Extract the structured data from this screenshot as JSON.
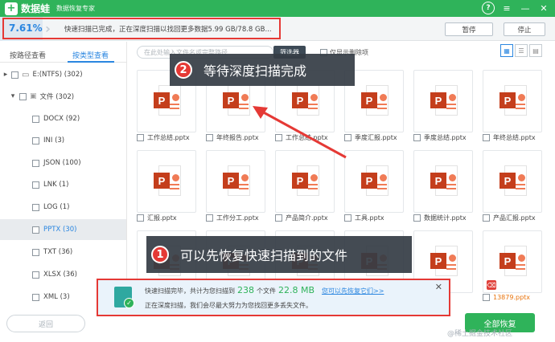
{
  "titlebar": {
    "logo_glyph": "+",
    "app_name": "数据蛙",
    "app_subtitle": "数据恢复专家",
    "controls": [
      {
        "name": "help-icon",
        "glyph": "?"
      },
      {
        "name": "menu-icon",
        "glyph": "≡"
      },
      {
        "name": "minimize-icon",
        "glyph": "—"
      },
      {
        "name": "close-icon",
        "glyph": "✕"
      }
    ]
  },
  "progress": {
    "percent_text": "7.61%",
    "fraction": 0.0761,
    "status_text": "快速扫描已完成，正在深度扫描以找回更多数据5.99 GB/78.8 GB...",
    "pause_label": "暂停",
    "stop_label": "停止"
  },
  "sidebar": {
    "tab_path": "按路径查看",
    "tab_type": "按类型查看",
    "active_tab": "type",
    "tree": [
      {
        "label": "E:(NTFS) (302)",
        "level": 0,
        "caret": "▸",
        "icon": "drive-icon"
      },
      {
        "label": "文件 (302)",
        "level": 1,
        "caret": "▾",
        "icon": "folder-icon"
      },
      {
        "label": "DOCX (92)",
        "level": 2
      },
      {
        "label": "INI (3)",
        "level": 2
      },
      {
        "label": "JSON (100)",
        "level": 2
      },
      {
        "label": "LNK (1)",
        "level": 2
      },
      {
        "label": "LOG (1)",
        "level": 2
      },
      {
        "label": "PPTX (30)",
        "level": 2,
        "selected": true
      },
      {
        "label": "TXT (36)",
        "level": 2
      },
      {
        "label": "XLSX (36)",
        "level": 2
      },
      {
        "label": "XML (3)",
        "level": 2
      }
    ]
  },
  "toolbar": {
    "search_placeholder": "在此处输入文件名或完整路径",
    "filter_label": "筛选器",
    "only_deleted_label": "仅显示删除项"
  },
  "files": {
    "row1": [
      "工作总结.pptx",
      "年终报告.pptx",
      "工作总结.pptx",
      "季度汇报.pptx",
      "季度总结.pptx",
      "年终总结.pptx"
    ],
    "row2": [
      "汇报.pptx",
      "工作分工.pptx",
      "产品简介.pptx",
      "工具.pptx",
      "数据统计.pptx",
      "产品汇报.pptx"
    ],
    "row3_last": "13879.pptx"
  },
  "callouts": {
    "step1_num": "1",
    "step1_text": "可以先恢复快速扫描到的文件",
    "step2_num": "2",
    "step2_text": "等待深度扫描完成"
  },
  "notification": {
    "line1_prefix": "快速扫描完毕，共计为您扫描到",
    "count": "238",
    "count_unit": "个文件",
    "size": "22.8 MB",
    "link_text": "您可以先恢复它们>>",
    "line2": "正在深度扫描，我们会尽最大努力为您找回更多丢失文件。",
    "close_glyph": "✕"
  },
  "footer": {
    "back_label": "返回",
    "recover_all_label": "全部恢复",
    "watermark": "@稀土掘金技术社区"
  },
  "colors": {
    "brand_green": "#2fb35a",
    "accent_blue": "#2a86e0",
    "highlight_red": "#e53935",
    "ppt_red": "#c43e1c"
  }
}
